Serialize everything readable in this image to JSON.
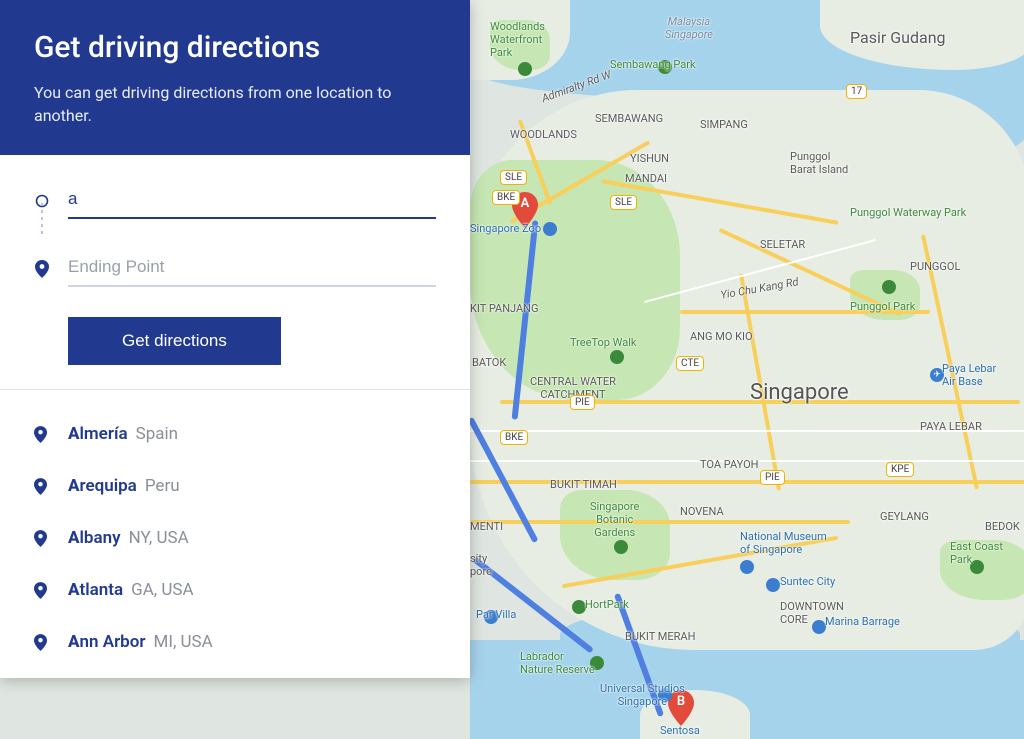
{
  "panel": {
    "title": "Get driving directions",
    "subtitle": "You can get driving directions from one location to another.",
    "start_input_value": "a",
    "end_placeholder": "Ending Point",
    "button_label": "Get directions"
  },
  "suggestions": [
    {
      "highlight": "A",
      "rest": "lmería",
      "secondary": "Spain"
    },
    {
      "highlight": "A",
      "rest": "requipa",
      "secondary": "Peru"
    },
    {
      "highlight": "A",
      "rest": "lbany",
      "secondary": "NY, USA"
    },
    {
      "highlight": "A",
      "rest": "tlanta",
      "secondary": "GA, USA"
    },
    {
      "highlight": "A",
      "rest": "nn Arbor",
      "secondary": "MI, USA"
    }
  ],
  "map": {
    "city_label": "Singapore",
    "marker_a": "A",
    "marker_b": "B",
    "labels": {
      "woodlands_waterfront": "Woodlands\nWaterfront\nPark",
      "pasir_gudang": "Pasir Gudang",
      "malaysia_sg": "Malaysia\nSingapore",
      "sembawang_park": "Sembawang Park",
      "admiralty_rd": "Admiralty Rd W",
      "woodlands": "WOODLANDS",
      "sembawang": "SEMBAWANG",
      "simpang": "SIMPANG",
      "yishun": "YISHUN",
      "mandai": "MANDAI",
      "punggol_barat": "Punggol\nBarat Island",
      "punggol_waterway": "Punggol Waterway Park",
      "seletar": "SELETAR",
      "punggol": "PUNGGOL",
      "singapore_zoo": "Singapore Zoo",
      "yio_chu_kang": "Yio Chu Kang Rd",
      "ang_mo_kio": "ANG MO KIO",
      "punggol_park": "Punggol Park",
      "paya_lebar_air": "Paya Lebar\nAir Base",
      "treetop": "TreeTop Walk",
      "central_catchment": "CENTRAL WATER\nCATCHMENT",
      "paya_lebar": "PAYA LEBAR",
      "kit_panjang": "KIT PANJANG",
      "batok": "BATOK",
      "toa_payoh": "TOA PAYOH",
      "bukit_timah": "BUKIT TIMAH",
      "geylang": "GEYLANG",
      "bedok": "BEDOK",
      "novena": "NOVENA",
      "botanic": "Singapore\nBotanic\nGardens",
      "national_museum": "National Museum\nof Singapore",
      "suntec": "Suntec City",
      "east_coast_park": "East Coast\nPark",
      "downtown_core": "DOWNTOWN\nCORE",
      "marina_barrage": "Marina Barrage",
      "menti": "MENTI",
      "sity_pore": "sity\npore",
      "par_villa": "Par Villa",
      "hortpark": "HortPark",
      "bukit_merah": "BUKIT MERAH",
      "labrador": "Labrador\nNature Reserve",
      "universal": "Universal Studios\nSingapore",
      "sentosa": "Sentosa",
      "sle": "SLE",
      "bke": "BKE",
      "pie": "PIE",
      "kpe": "KPE",
      "cte": "CTE",
      "route17": "17"
    }
  }
}
